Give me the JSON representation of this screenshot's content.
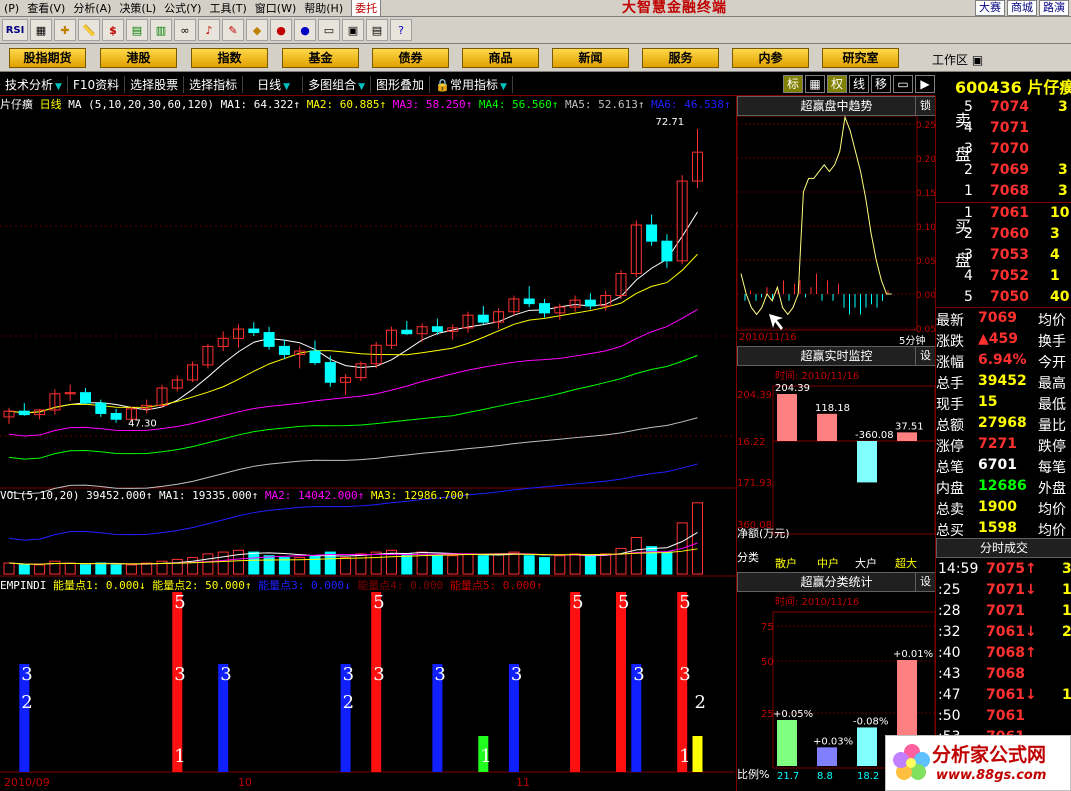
{
  "menu": [
    "(P)",
    "查看(V)",
    "分析(A)",
    "决策(L)",
    "公式(Y)",
    "工具(T)",
    "窗口(W)",
    "帮助(H)"
  ],
  "entrust": "委托",
  "app_title": "大智慧金融终端",
  "right_links": [
    "大赛",
    "商城",
    "路演"
  ],
  "toolbar_rsi": "RSI",
  "nav_buttons": [
    "股指期货",
    "港股",
    "指数",
    "基金",
    "债券",
    "商品",
    "新闻",
    "服务",
    "内参",
    "研究室"
  ],
  "workarea": "工作区",
  "tabs": [
    "技术分析",
    "F10资料",
    "选择股票",
    "选择指标",
    "日线",
    "多图组合",
    "图形叠加",
    "常用指标"
  ],
  "tab_buttons": [
    "标",
    "权",
    "线",
    "移"
  ],
  "stock": {
    "code": "600436",
    "name": "片仔癀"
  },
  "kline": {
    "name": "片仔癀",
    "period": "日线",
    "ma_label": "MA (5,10,20,30,60,120)",
    "ma1": "MA1: 64.322↑",
    "ma2": "MA2: 60.885↑",
    "ma3": "MA3: 58.250↑",
    "ma4": "MA4: 56.560↑",
    "ma5": "MA5: 52.613↑",
    "ma6": "MA6: 46.538↑",
    "high_label": "72.71",
    "low_label": "47.30"
  },
  "vol": {
    "label": "VOL(5,10,20)",
    "value": "39452.000↑",
    "ma1": "MA1: 19335.000↑",
    "ma2": "MA2: 14042.000↑",
    "ma3": "MA3: 12986.700↑"
  },
  "empindi": {
    "label": "EMPINDI",
    "p1": "能量点1: 0.000↓",
    "p2": "能量点2: 50.000↑",
    "p3": "能量点3: 0.000↓",
    "p4": "能量点4: 0.000",
    "p5": "能量点5: 0.000↑"
  },
  "x_axis": [
    "2010/09",
    "10",
    "11"
  ],
  "trend_panel": {
    "title": "超赢盘中趋势",
    "lock": "锁",
    "date": "2010/11/16",
    "interval": "5分钟",
    "y_ticks": [
      "0.25",
      "0.20",
      "0.15",
      "0.10",
      "0.05",
      "0.00",
      "-0.05"
    ]
  },
  "monitor_panel": {
    "title": "超赢实时监控",
    "set": "设",
    "time": "时间: 2010/11/16",
    "y_ticks": [
      "204.39",
      "16.22",
      "171.93",
      "360.08"
    ],
    "bar_values": [
      "204.39",
      "118.18",
      "-360.08",
      "37.51"
    ],
    "net_label": "净额(万元)",
    "class_label": "分类",
    "classes": [
      "散户",
      "中户",
      "大户",
      "超大"
    ]
  },
  "class_panel": {
    "title": "超赢分类统计",
    "set": "设",
    "time": "时间: 2010/11/16",
    "y_ticks": [
      "75",
      "50",
      "25"
    ],
    "bar_values": [
      "+0.05%",
      "+0.03%",
      "-0.08%",
      "+0.01%"
    ],
    "bottom_values": [
      "21.7",
      "8.8",
      "18.2"
    ],
    "ratio_label": "比例%"
  },
  "order_book": {
    "sell_side": "卖盘",
    "buy_side": "买盘",
    "sell": [
      {
        "lvl": "5",
        "price": "7074",
        "vol": "3"
      },
      {
        "lvl": "4",
        "price": "7071",
        "vol": ""
      },
      {
        "lvl": "3",
        "price": "7070",
        "vol": ""
      },
      {
        "lvl": "2",
        "price": "7069",
        "vol": "3"
      },
      {
        "lvl": "1",
        "price": "7068",
        "vol": "3"
      }
    ],
    "buy": [
      {
        "lvl": "1",
        "price": "7061",
        "vol": "10"
      },
      {
        "lvl": "2",
        "price": "7060",
        "vol": "3"
      },
      {
        "lvl": "3",
        "price": "7053",
        "vol": "4"
      },
      {
        "lvl": "4",
        "price": "7052",
        "vol": "1"
      },
      {
        "lvl": "5",
        "price": "7050",
        "vol": "40"
      }
    ]
  },
  "quote": [
    {
      "k": "最新",
      "v": "7069",
      "k2": "均价"
    },
    {
      "k": "涨跌",
      "v": "▲459",
      "k2": "换手"
    },
    {
      "k": "涨幅",
      "v": "6.94%",
      "k2": "今开"
    },
    {
      "k": "总手",
      "v": "39452",
      "k2": "最高"
    },
    {
      "k": "现手",
      "v": "15",
      "k2": "最低"
    },
    {
      "k": "总额",
      "v": "27968",
      "k2": "量比"
    },
    {
      "k": "涨停",
      "v": "7271",
      "k2": "跌停"
    },
    {
      "k": "总笔",
      "v": "6701",
      "k2": "每笔"
    },
    {
      "k": "内盘",
      "v": "12686",
      "k2": "外盘"
    },
    {
      "k": "总卖",
      "v": "1900",
      "k2": "均价"
    },
    {
      "k": "总买",
      "v": "1598",
      "k2": "均价"
    }
  ],
  "ticks_title": "分时成交",
  "ticks": [
    {
      "t": "14:59",
      "p": "7075↑",
      "v": "3"
    },
    {
      "t": ":25",
      "p": "7071↓",
      "v": "1"
    },
    {
      "t": ":28",
      "p": "7071",
      "v": "1"
    },
    {
      "t": ":32",
      "p": "7061↓",
      "v": "2"
    },
    {
      "t": ":40",
      "p": "7068↑",
      "v": ""
    },
    {
      "t": ":43",
      "p": "7068",
      "v": ""
    },
    {
      "t": ":47",
      "p": "7061↓",
      "v": "1"
    },
    {
      "t": ":50",
      "p": "7061",
      "v": ""
    },
    {
      "t": ":53",
      "p": "7061",
      "v": ""
    }
  ],
  "logo": {
    "text": "分析家公式网",
    "url": "www.88gs.com"
  },
  "colors": {
    "up": "#ff3030",
    "down": "#00ffff",
    "ma1": "#ffffff",
    "ma2": "#ffff00",
    "ma3": "#ff00ff",
    "ma4": "#00ff00",
    "ma5": "#c0c0c0",
    "ma6": "#2020ff",
    "bg": "#000000",
    "grid": "#800000"
  },
  "emp_bars": [
    {
      "i": 1,
      "color": "blue",
      "value": 3,
      "labels": [
        "3",
        "2"
      ]
    },
    {
      "i": 11,
      "color": "red",
      "value": 5,
      "labels": [
        "5",
        "3",
        "1"
      ]
    },
    {
      "i": 14,
      "color": "blue",
      "value": 3,
      "labels": [
        "3"
      ]
    },
    {
      "i": 22,
      "color": "blue",
      "value": 3,
      "labels": [
        "3",
        "2"
      ]
    },
    {
      "i": 24,
      "color": "red",
      "value": 5,
      "labels": [
        "5",
        "3"
      ]
    },
    {
      "i": 28,
      "color": "blue",
      "value": 3,
      "labels": [
        "3"
      ]
    },
    {
      "i": 31,
      "color": "green",
      "value": 1,
      "labels": [
        "1"
      ]
    },
    {
      "i": 33,
      "color": "blue",
      "value": 3,
      "labels": [
        "3"
      ]
    },
    {
      "i": 37,
      "color": "red",
      "value": 5,
      "labels": [
        "5"
      ]
    },
    {
      "i": 40,
      "color": "red",
      "value": 5,
      "labels": [
        "5"
      ]
    },
    {
      "i": 41,
      "color": "blue",
      "value": 3,
      "labels": [
        "3"
      ]
    },
    {
      "i": 44,
      "color": "red",
      "value": 5,
      "labels": [
        "5",
        "3",
        "1"
      ]
    },
    {
      "i": 45,
      "color": "yellow",
      "value": 1,
      "labels": [
        "2"
      ]
    }
  ],
  "candles": [
    [
      47.8,
      48.6,
      47.2,
      48.3
    ],
    [
      48.3,
      49.0,
      47.9,
      48.0
    ],
    [
      48.0,
      48.5,
      47.6,
      48.4
    ],
    [
      48.4,
      50.2,
      48.0,
      49.8
    ],
    [
      49.8,
      50.6,
      49.2,
      49.9
    ],
    [
      49.9,
      50.3,
      48.9,
      49.0
    ],
    [
      49.0,
      49.3,
      47.8,
      48.1
    ],
    [
      48.1,
      48.5,
      47.3,
      47.6
    ],
    [
      47.6,
      48.7,
      47.4,
      48.5
    ],
    [
      48.5,
      49.3,
      48.1,
      48.8
    ],
    [
      48.8,
      50.6,
      48.6,
      50.3
    ],
    [
      50.3,
      51.4,
      50.0,
      51.0
    ],
    [
      51.0,
      52.6,
      50.8,
      52.3
    ],
    [
      52.3,
      54.1,
      52.0,
      53.9
    ],
    [
      53.9,
      55.2,
      53.5,
      54.6
    ],
    [
      54.6,
      55.8,
      53.8,
      55.4
    ],
    [
      55.4,
      56.0,
      54.8,
      55.1
    ],
    [
      55.1,
      55.6,
      53.6,
      53.9
    ],
    [
      53.9,
      54.5,
      52.8,
      53.2
    ],
    [
      53.2,
      53.9,
      52.0,
      53.5
    ],
    [
      53.5,
      54.4,
      52.3,
      52.5
    ],
    [
      52.5,
      53.1,
      50.4,
      50.8
    ],
    [
      50.8,
      51.5,
      49.7,
      51.2
    ],
    [
      51.2,
      52.6,
      50.9,
      52.4
    ],
    [
      52.4,
      54.3,
      52.0,
      54.0
    ],
    [
      54.0,
      55.6,
      53.7,
      55.3
    ],
    [
      55.3,
      56.1,
      54.9,
      55.0
    ],
    [
      55.0,
      55.9,
      54.3,
      55.6
    ],
    [
      55.6,
      56.3,
      54.9,
      55.2
    ],
    [
      55.2,
      55.8,
      54.5,
      55.5
    ],
    [
      55.5,
      56.9,
      55.1,
      56.6
    ],
    [
      56.6,
      57.4,
      55.8,
      56.0
    ],
    [
      56.0,
      57.2,
      55.4,
      56.9
    ],
    [
      56.9,
      58.3,
      56.6,
      58.0
    ],
    [
      58.0,
      59.1,
      57.3,
      57.6
    ],
    [
      57.6,
      58.0,
      56.4,
      56.8
    ],
    [
      56.8,
      57.6,
      56.2,
      57.3
    ],
    [
      57.3,
      58.3,
      56.9,
      57.9
    ],
    [
      57.9,
      58.5,
      57.1,
      57.4
    ],
    [
      57.4,
      58.7,
      57.0,
      58.3
    ],
    [
      58.3,
      60.5,
      58.0,
      60.2
    ],
    [
      60.2,
      64.8,
      59.9,
      64.4
    ],
    [
      64.4,
      65.3,
      62.6,
      63.0
    ],
    [
      63.0,
      63.6,
      60.7,
      61.3
    ],
    [
      61.3,
      68.7,
      61.0,
      68.2
    ],
    [
      68.2,
      72.7,
      67.6,
      70.7
    ]
  ],
  "volumes": [
    6,
    5,
    5,
    7,
    6,
    5,
    6,
    5,
    5,
    6,
    7,
    8,
    9,
    11,
    12,
    13,
    12,
    10,
    9,
    9,
    10,
    12,
    9,
    11,
    12,
    13,
    11,
    12,
    10,
    10,
    11,
    10,
    11,
    12,
    10,
    9,
    10,
    11,
    10,
    11,
    14,
    20,
    15,
    12,
    28,
    39
  ],
  "trend_line": [
    0.03,
    0.0,
    -0.02,
    -0.03,
    -0.02,
    0.0,
    -0.01,
    0.01,
    -0.02,
    -0.03,
    -0.02,
    0.0,
    0.15,
    0.17,
    0.17,
    0.18,
    0.19,
    0.18,
    0.19,
    0.21,
    0.26,
    0.24,
    0.21,
    0.18,
    0.14,
    0.09,
    0.05,
    0.02,
    0.0,
    0.0
  ],
  "trend_bars": [
    -0.01,
    0.005,
    -0.01,
    -0.005,
    0.01,
    -0.01,
    0.005,
    0.02,
    -0.01,
    0.015,
    0.02,
    -0.005,
    0.01,
    0.03,
    -0.01,
    0.02,
    -0.01,
    0.015,
    -0.02,
    -0.03,
    -0.02,
    -0.03,
    -0.02,
    -0.015,
    -0.02,
    -0.01,
    0.005
  ]
}
